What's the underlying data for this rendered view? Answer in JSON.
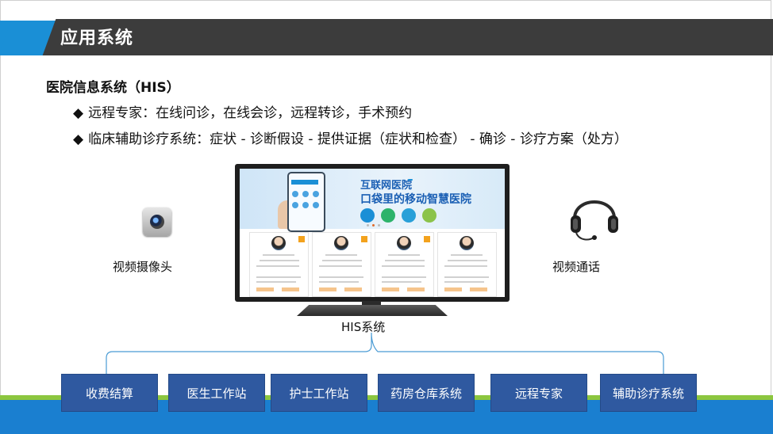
{
  "header": {
    "title": "应用系统"
  },
  "section": {
    "title": "医院信息系统（HIS）",
    "bullets": [
      {
        "marker": "◆",
        "text": "远程专家：在线问诊，在线会诊，远程转诊，手术预约"
      },
      {
        "marker": "◆",
        "text": "临床辅助诊疗系统：症状 - 诊断假设 - 提供证据（症状和检查） - 确诊 - 诊疗方案（处方）"
      }
    ]
  },
  "devices": {
    "camera_label": "视频摄像头",
    "video_call_label": "视频通话",
    "his_label": "HIS系统"
  },
  "screen": {
    "banner_title": "互联网医院",
    "banner_subtitle": "口袋里的移动智慧医院"
  },
  "modules": [
    {
      "label": "收费结算"
    },
    {
      "label": "医生工作站"
    },
    {
      "label": "护士工作站"
    },
    {
      "label": "药房仓库系统"
    },
    {
      "label": "远程专家"
    },
    {
      "label": "辅助诊疗系统"
    }
  ],
  "colors": {
    "header_dark": "#3c3c3c",
    "header_accent": "#1a8fd6",
    "module_box": "#2f59a0",
    "bottom_green": "#8cc63f",
    "bottom_blue": "#1a7fd0"
  }
}
